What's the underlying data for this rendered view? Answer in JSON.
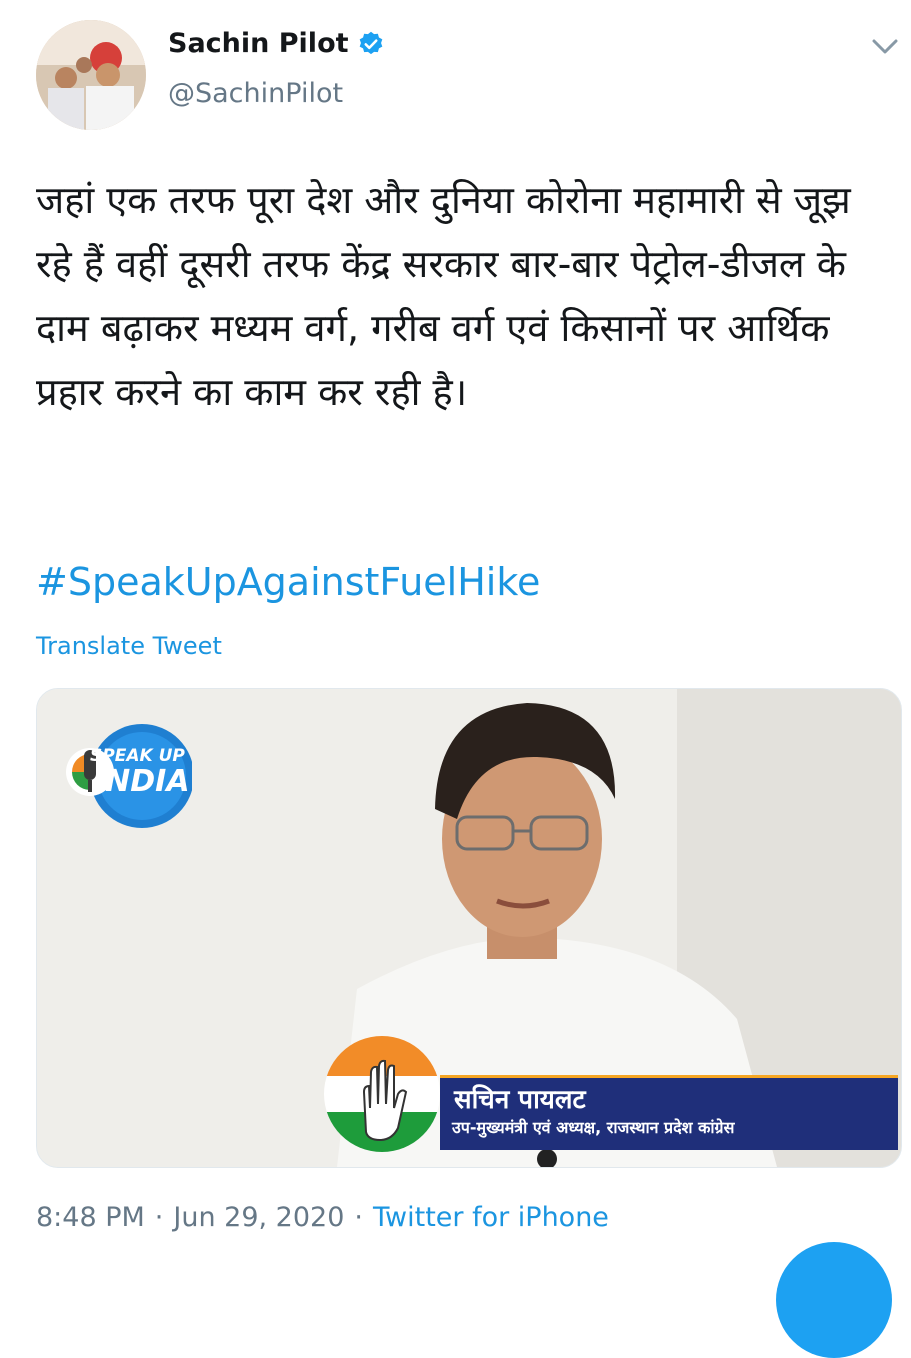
{
  "author": {
    "display_name": "Sachin Pilot",
    "handle": "@SachinPilot",
    "verified": true
  },
  "tweet": {
    "text": "जहां एक तरफ पूरा देश और दुनिया कोरोना महामारी से जूझ रहे हैं वहीं दूसरी तरफ केंद्र सरकार बार-बार पेट्रोल-डीजल के दाम बढ़ाकर मध्यम वर्ग, गरीब वर्ग एवं किसानों पर आर्थिक प्रहार करने का काम कर रही है।",
    "hashtag": "#SpeakUpAgainstFuelHike",
    "translate_label": "Translate Tweet"
  },
  "media": {
    "logo_line1": "SPEAK UP",
    "logo_line2": "INDIA",
    "caption_name": "सचिन पायलट",
    "caption_title": "उप-मुख्यमंत्री एवं अध्यक्ष, राजस्थान प्रदेश कांग्रेस"
  },
  "meta": {
    "time": "8:48 PM",
    "separator": "·",
    "date": "Jun 29, 2020",
    "source": "Twitter for iPhone"
  },
  "icons": {
    "verified": "verified-badge-icon",
    "menu": "chevron-down-icon"
  },
  "colors": {
    "link": "#1b95e0",
    "secondary_text": "#657786"
  }
}
